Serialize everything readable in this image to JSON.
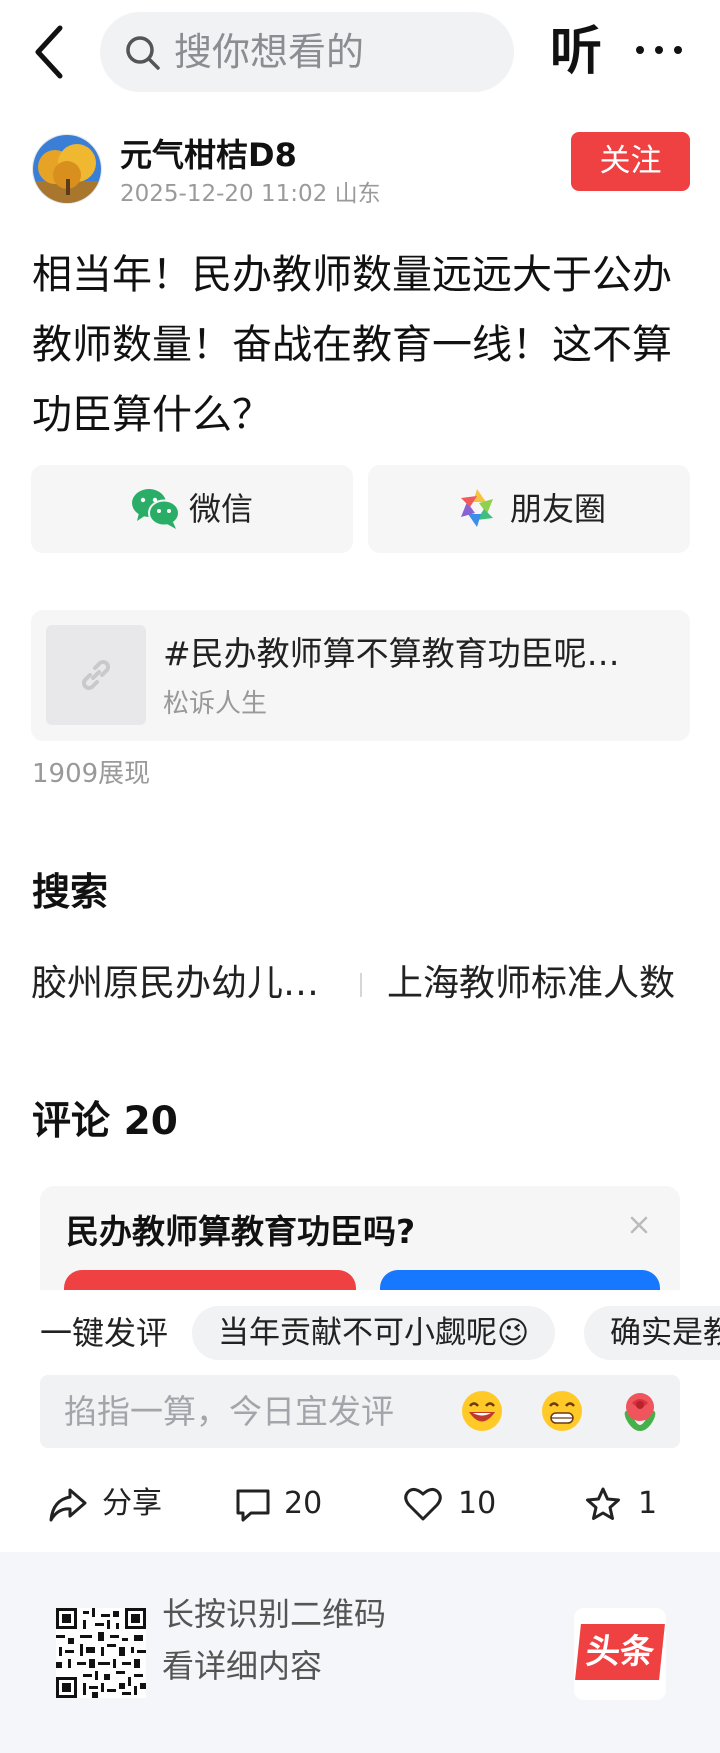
{
  "header": {
    "search_placeholder": "搜你想看的",
    "listen_label": "听"
  },
  "author": {
    "name": "元气柑桔D8",
    "datetime": "2025-12-20 11:02",
    "location": "山东",
    "follow_label": "关注"
  },
  "post": {
    "text": "相当年！民办教师数量远远大于公办教师数量！奋战在教育一线！这不算功臣算什么？"
  },
  "share": {
    "wechat_label": "微信",
    "moments_label": "朋友圈"
  },
  "link_card": {
    "title": "#民办教师算不算教育功臣呢…",
    "source": "松诉人生"
  },
  "views": "1909展现",
  "search_section": {
    "title": "搜索",
    "suggestions": [
      "胶州原民办幼儿…",
      "上海教师标准人数"
    ]
  },
  "comments": {
    "title": "评论 20"
  },
  "poll": {
    "question": "民办教师算教育功臣吗?"
  },
  "quick_comment": {
    "label": "一键发评",
    "chips": [
      "当年贡献不可小觑呢😉",
      "确实是教"
    ]
  },
  "comment_input": {
    "placeholder": "掐指一算，今日宜发评",
    "emojis": [
      "laughing-emoji",
      "grinning-emoji",
      "rose-emoji"
    ]
  },
  "actions": {
    "share_label": "分享",
    "comment_count": "20",
    "like_count": "10",
    "favorite_count": "1"
  },
  "footer": {
    "line1": "长按识别二维码",
    "line2": "看详细内容",
    "logo_text": "头条"
  },
  "colors": {
    "accent_red": "#f04142",
    "accent_blue": "#1677ff",
    "wechat_green": "#2aae67"
  }
}
